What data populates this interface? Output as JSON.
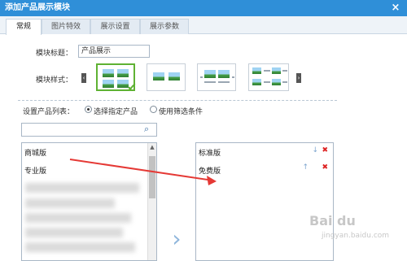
{
  "window": {
    "title": "添加产品展示模块"
  },
  "tabs": [
    {
      "label": "常规"
    },
    {
      "label": "图片特效"
    },
    {
      "label": "展示设置"
    },
    {
      "label": "展示参数"
    }
  ],
  "form": {
    "title_label": "模块标题：",
    "title_value": "产品展示",
    "style_label": "模块样式："
  },
  "selection": {
    "label": "设置产品列表：",
    "option1": "选择指定产品",
    "option2": "使用筛选条件"
  },
  "left_list": {
    "items": [
      "商城版",
      "专业版"
    ]
  },
  "right_list": {
    "items": [
      "标准版",
      "免费版"
    ]
  },
  "watermark": {
    "text": "Bai du",
    "sub": "jingyan.baidu.com"
  },
  "colors": {
    "titlebar": "#2f8fd8",
    "selected_border": "#5fb233",
    "arrow": "#e53935"
  }
}
